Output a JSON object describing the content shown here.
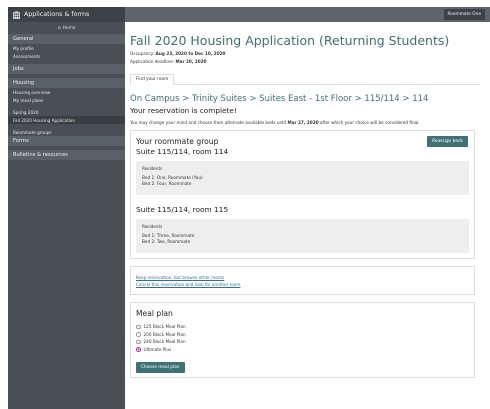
{
  "app": {
    "title": "Applications & forms"
  },
  "topbar": {
    "user_button": "Roommate One"
  },
  "sidebar": {
    "home": "Home",
    "sections": [
      {
        "label": "General",
        "items": [
          "My profile",
          "Assessments"
        ]
      },
      {
        "label": "Jobs",
        "items": []
      },
      {
        "label": "Housing",
        "items": [
          "Housing overview",
          "My meal plans"
        ]
      }
    ],
    "term": "Spring 2020",
    "active_item": "Fall 2020 Housing Application",
    "roommate_groups": "Roommate groups",
    "forms": "Forms",
    "bulletins": "Bulletins & resources"
  },
  "page": {
    "title": "Fall 2020 Housing Application (Returning Students)",
    "occupancy_label": "Occupancy:",
    "occupancy_value": "Aug 23, 2020 to Dec 10, 2020",
    "deadline_label": "Application deadline:",
    "deadline_value": "Mar 20, 2020",
    "tab": "Find your room",
    "breadcrumb": "On Campus > Trinity Suites > Suites East - 1st Floor > 115/114 > 114",
    "complete_msg": "Your reservation is complete!",
    "note_pre": "You may change your mind and choose from alternate available beds until",
    "note_date": "Mar 27, 2020",
    "note_post": "after which your choice will be considered final."
  },
  "roommate_group": {
    "title": "Your roommate group",
    "reassign_button": "Reassign beds",
    "suites": [
      {
        "title": "Suite 115/114, room 114",
        "residents_label": "Residents",
        "beds": [
          "Bed 1: One, Roommate (You)",
          "Bed 2: Four, Roommate"
        ]
      },
      {
        "title": "Suite 115/114, room 115",
        "residents_label": "Residents",
        "beds": [
          "Bed 1: Three, Roommate",
          "Bed 2: Two, Roommate"
        ]
      }
    ]
  },
  "links": {
    "keep": "Keep reservation, but browse other rooms",
    "cancel": "Cancel this reservation and look for another room"
  },
  "meal_plan": {
    "title": "Meal plan",
    "options": [
      "125 Block Meal Plan",
      "200 Block Meal Plan",
      "240 Block Meal Plan",
      "Ultimate Plus"
    ],
    "selected": "Ultimate Plus",
    "choose_button": "Choose meal plan"
  },
  "colors": {
    "accent": "#3e7275",
    "title": "#3f6f73",
    "sidebar": "#4a4f55",
    "link": "#2f6f9f",
    "radio_checked": "#b33aa6"
  }
}
